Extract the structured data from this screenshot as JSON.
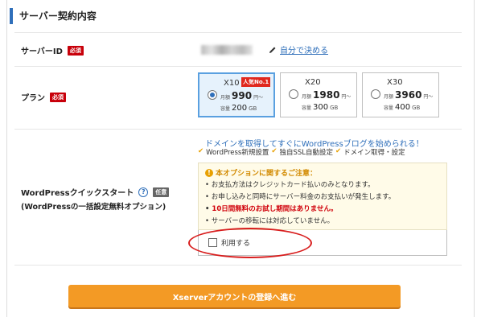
{
  "section": {
    "title": "サーバー契約内容"
  },
  "server_id": {
    "label": "サーバーID",
    "required_badge": "必須",
    "self_link": "自分で決める"
  },
  "plan": {
    "label": "プラン",
    "required_badge": "必須",
    "options": [
      {
        "name": "X10",
        "badge": "人気No.1",
        "monthly_prefix": "月額",
        "price": "990",
        "yen_suffix": "円〜",
        "storage_prefix": "容量",
        "storage": "200",
        "storage_unit": "GB",
        "selected": true
      },
      {
        "name": "X20",
        "badge": "",
        "monthly_prefix": "月額",
        "price": "1980",
        "yen_suffix": "円〜",
        "storage_prefix": "容量",
        "storage": "300",
        "storage_unit": "GB",
        "selected": false
      },
      {
        "name": "X30",
        "badge": "",
        "monthly_prefix": "月額",
        "price": "3960",
        "yen_suffix": "円〜",
        "storage_prefix": "容量",
        "storage": "400",
        "storage_unit": "GB",
        "selected": false
      }
    ]
  },
  "wordpress": {
    "label_line1": "WordPressクイックスタート",
    "label_line2": "(WordPressの一括設定無料オプション)",
    "optional_badge": "任意",
    "promo": "ドメインを取得してすぐにWordPressブログを始められる！",
    "checks": [
      "WordPress新規設置",
      "独自SSL自動設定",
      "ドメイン取得・設定"
    ],
    "notice_title": "本オプションに関するご注意：",
    "notices": [
      "お支払方法はクレジットカード払いのみとなります。",
      "お申し込みと同時にサーバー料金のお支払いが発生します。",
      "10日間無料のお試し期間はありません。",
      "サーバーの移転には対応していません。"
    ],
    "use_label": "利用する"
  },
  "submit": {
    "label": "Xserverアカウントの登録へ進む"
  },
  "colors": {
    "accent": "#2f6fba",
    "required": "#c8000a",
    "button": "#f39a25",
    "highlight": "#d81e1e"
  }
}
